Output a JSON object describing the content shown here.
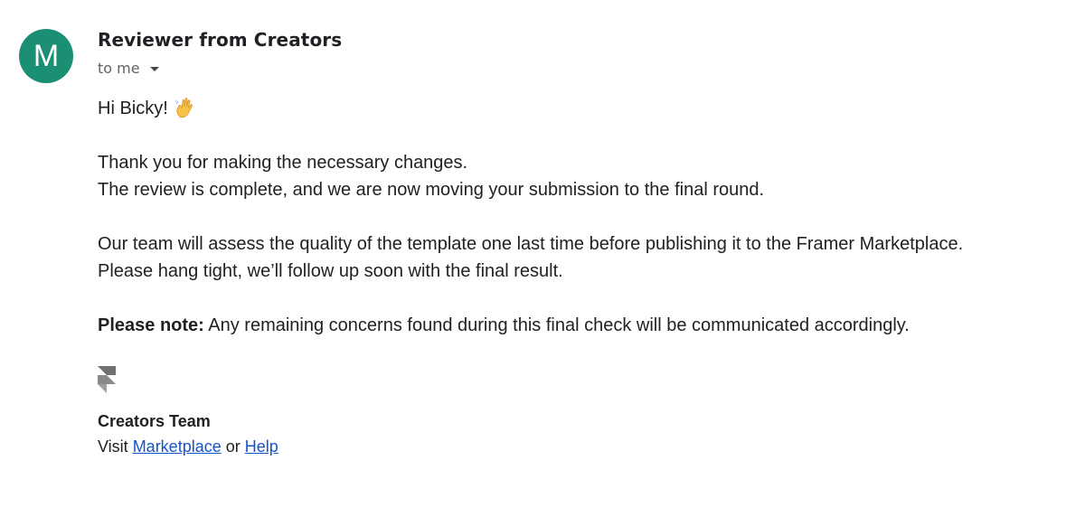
{
  "sender": {
    "avatar_letter": "M",
    "avatar_color": "#1a8f73",
    "name": "Reviewer from Creators",
    "recipient_label": "to me"
  },
  "message": {
    "greeting": "Hi Bicky!",
    "greeting_emoji_icon": "waving-hand-icon",
    "paragraph1_line1": "Thank you for making the necessary changes.",
    "paragraph1_line2": "The review is complete, and we are now moving your submission to the final round.",
    "paragraph2_line1": "Our team will assess the quality of the template one last time before publishing it to the Framer Marketplace.",
    "paragraph2_line2": "Please hang tight, we’ll follow up soon with the final result.",
    "note_label": "Please note:",
    "note_text": " Any remaining concerns found during this final check will be communicated accordingly."
  },
  "signature": {
    "logo_icon": "framer-logo-icon",
    "team_name": "Creators Team",
    "visit_prefix": "Visit ",
    "marketplace_link": "Marketplace",
    "connector": " or ",
    "help_link": "Help"
  },
  "colors": {
    "link": "#1155cc",
    "text": "#202124",
    "muted": "#5f6368"
  }
}
